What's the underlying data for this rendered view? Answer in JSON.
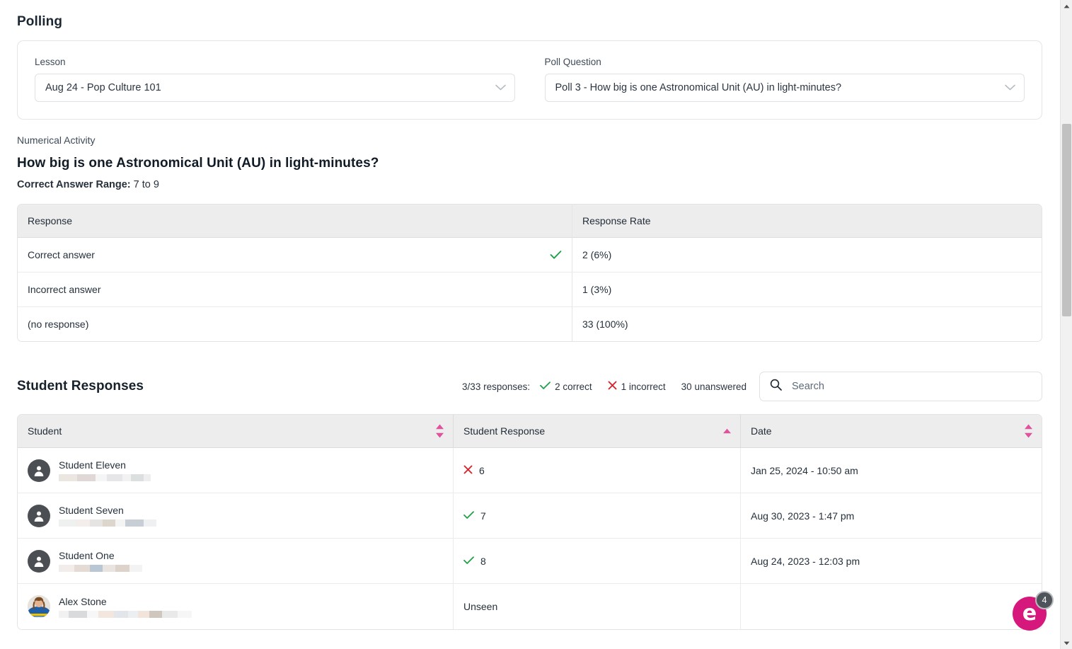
{
  "page": {
    "title": "Polling"
  },
  "selectors": {
    "lesson": {
      "label": "Lesson",
      "value": "Aug 24 - Pop Culture 101",
      "icon": "chevron-down-icon"
    },
    "poll_question": {
      "label": "Poll Question",
      "value": "Poll 3 - How big is one Astronomical Unit (AU) in light-minutes?",
      "icon": "chevron-down-icon"
    }
  },
  "activity": {
    "kind": "Numerical Activity",
    "title": "How big is one Astronomical Unit (AU) in light-minutes?",
    "range_label": "Correct Answer Range:",
    "range_value": "7 to 9"
  },
  "response_table": {
    "columns": [
      "Response",
      "Response Rate"
    ],
    "rows": [
      {
        "response": "Correct answer",
        "rate": "2 (6%)",
        "icon": "check-icon"
      },
      {
        "response": "Incorrect answer",
        "rate": "1 (3%)",
        "icon": ""
      },
      {
        "response": "(no response)",
        "rate": "33 (100%)",
        "icon": ""
      }
    ]
  },
  "student_responses": {
    "title": "Student Responses",
    "summary": {
      "lead": "3/33 responses:",
      "correct": "2 correct",
      "incorrect": "1 incorrect",
      "unanswered": "30 unanswered",
      "correct_icon": "check-icon",
      "incorrect_icon": "x-icon"
    },
    "search": {
      "placeholder": "Search",
      "value": "",
      "icon": "search-icon"
    },
    "columns": [
      {
        "label": "Student",
        "sort": "none",
        "sort_icon": "sort-both-icon"
      },
      {
        "label": "Student Response",
        "sort": "asc",
        "sort_icon": "sort-asc-icon"
      },
      {
        "label": "Date",
        "sort": "none",
        "sort_icon": "sort-both-icon"
      }
    ],
    "rows": [
      {
        "name": "Student Eleven",
        "avatar": "person-icon",
        "response": "6",
        "status": "incorrect",
        "status_icon": "x-icon",
        "date": "Jan 25, 2024 - 10:50 am"
      },
      {
        "name": "Student Seven",
        "avatar": "person-icon",
        "response": "7",
        "status": "correct",
        "status_icon": "check-icon",
        "date": "Aug 30, 2023 - 1:47 pm"
      },
      {
        "name": "Student One",
        "avatar": "person-icon",
        "response": "8",
        "status": "correct",
        "status_icon": "check-icon",
        "date": "Aug 24, 2023 - 12:03 pm"
      },
      {
        "name": "Alex Stone",
        "avatar": "photo-avatar",
        "response": "Unseen",
        "status": "unseen",
        "status_icon": "",
        "date": ""
      }
    ]
  },
  "chat_widget": {
    "label": "e",
    "badge": "4",
    "icon": "chat-icon"
  },
  "scrollbar": {
    "up_icon": "caret-up-icon",
    "down_icon": "caret-down-icon"
  },
  "colors": {
    "accent_pink": "#e0529c",
    "brand_magenta": "#d6187d",
    "correct_green": "#21a04a",
    "incorrect_red": "#d8232a",
    "header_gray": "#ededed"
  }
}
